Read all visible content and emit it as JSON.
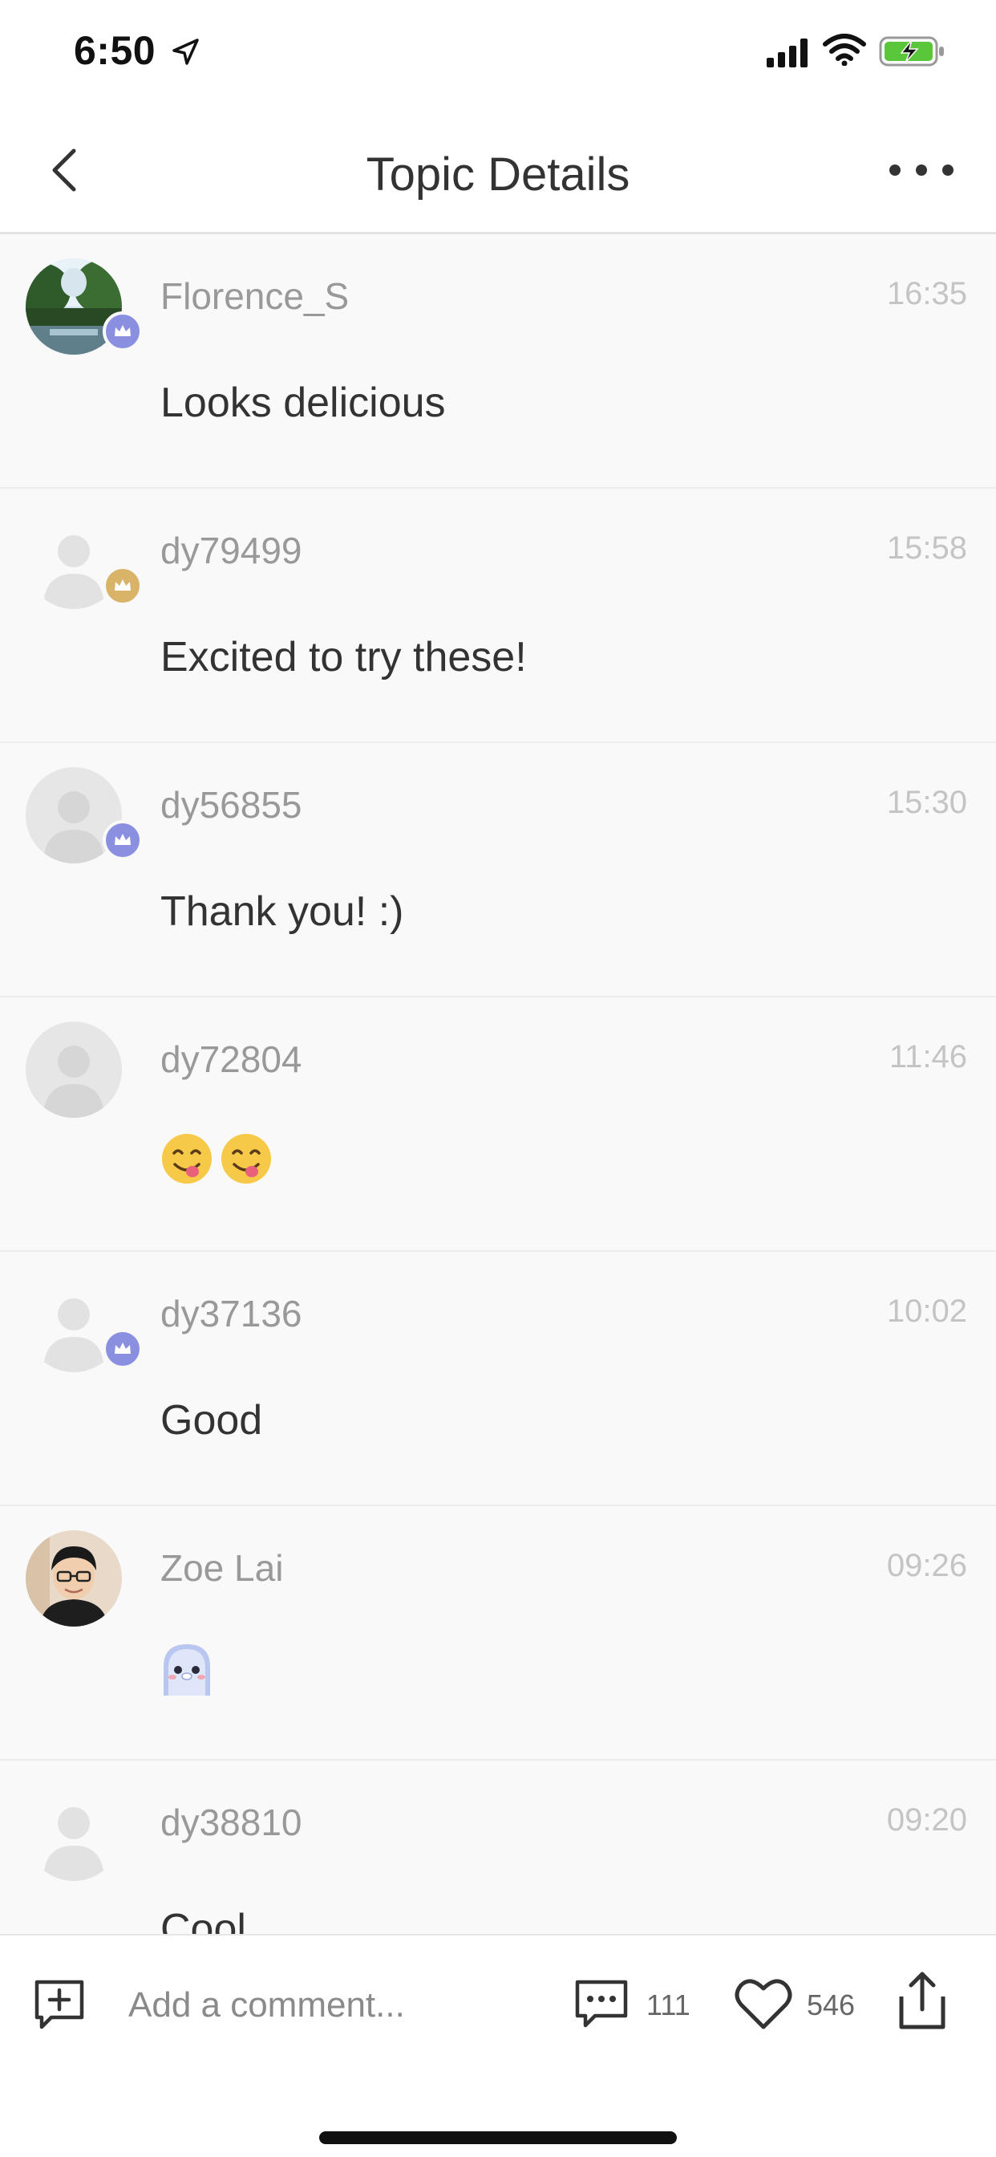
{
  "status_bar": {
    "time": "6:50"
  },
  "nav": {
    "title": "Topic Details"
  },
  "comments": [
    {
      "username": "Florence_S",
      "time": "16:35",
      "text": "Looks delicious",
      "avatar": "photo-landscape",
      "badge": "crown-purple"
    },
    {
      "username": "dy79499",
      "time": "15:58",
      "text": "Excited to try these!",
      "avatar": "default-plain",
      "badge": "crown-gold"
    },
    {
      "username": "dy56855",
      "time": "15:30",
      "text": "Thank you! :)",
      "avatar": "default-circle",
      "badge": "crown-purple"
    },
    {
      "username": "dy72804",
      "time": "11:46",
      "text": "",
      "emoji": [
        "😋",
        "😋"
      ],
      "avatar": "default-circle",
      "badge": ""
    },
    {
      "username": "dy37136",
      "time": "10:02",
      "text": "Good",
      "avatar": "default-plain",
      "badge": "crown-purple"
    },
    {
      "username": "Zoe Lai",
      "time": "09:26",
      "text": "",
      "sticker": "ghost-sticker",
      "avatar": "photo-person",
      "badge": ""
    },
    {
      "username": "dy38810",
      "time": "09:20",
      "text": "Cool",
      "avatar": "default-plain",
      "badge": ""
    }
  ],
  "bottom_bar": {
    "comment_placeholder": "Add a comment...",
    "comments_count": "111",
    "likes_count": "546"
  },
  "colors": {
    "crown_purple": "#8a8fe0",
    "crown_gold": "#d9b468",
    "battery_green": "#5ac63a"
  }
}
